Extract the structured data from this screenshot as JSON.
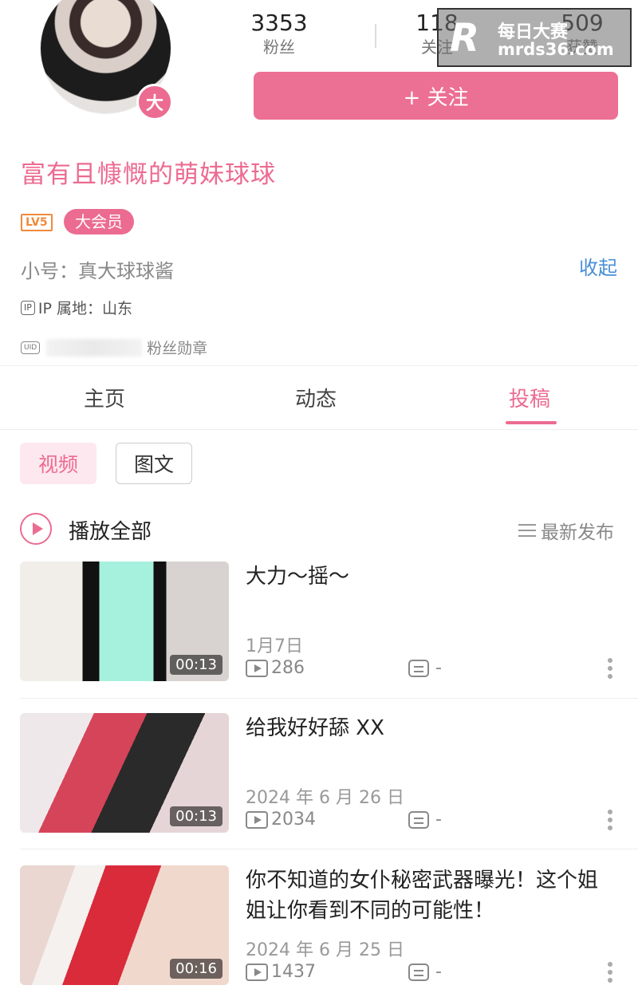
{
  "profile": {
    "avatar_badge": "大",
    "username": "富有且慷慨的萌妹球球",
    "level": "LV5",
    "vip": "大会员",
    "alt_account": "小号：真大球球酱",
    "collapse": "收起",
    "ip_icon": "IP",
    "ip_location": "IP 属地：山东",
    "uid_icon": "UID",
    "fan_medal": "粉丝勋章"
  },
  "stats": {
    "followers": "3353",
    "followers_label": "粉丝",
    "following": "118",
    "following_label": "关注",
    "likes": "509",
    "likes_label": "获赞"
  },
  "follow_button": "+ 关注",
  "watermark": {
    "logo": "R",
    "title": "每日大赛",
    "url": "mrds36.com"
  },
  "tabs": {
    "home": "主页",
    "dynamic": "动态",
    "posts": "投稿"
  },
  "filters": {
    "video": "视频",
    "image_text": "图文"
  },
  "play_all": "播放全部",
  "sort": "最新发布",
  "videos": [
    {
      "title": "大力～摇～",
      "duration": "00:13",
      "date": "1月7日",
      "plays": "286",
      "comments": "-"
    },
    {
      "title": "给我好好舔 XX",
      "duration": "00:13",
      "date": "2024 年 6 月 26 日",
      "plays": "2034",
      "comments": "-"
    },
    {
      "title": "你不知道的女仆秘密武器曝光！这个姐姐让你看到不同的可能性！",
      "duration": "00:16",
      "date": "2024 年 6 月 25 日",
      "plays": "1437",
      "comments": "-"
    }
  ],
  "colors": {
    "accent": "#ec6b91",
    "link": "#4a8fd6",
    "level": "#f08a3c"
  }
}
